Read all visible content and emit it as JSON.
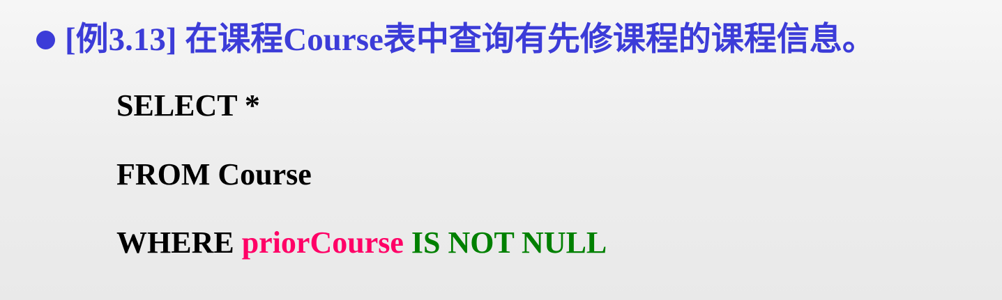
{
  "colors": {
    "heading": "#3c3cd8",
    "bullet": "#3c3cd8",
    "keyword": "#000000",
    "column": "#ff0066",
    "condition": "#008000"
  },
  "heading": {
    "bullet_icon": "filled-circle",
    "text": "[例3.13] 在课程Course表中查询有先修课程的课程信息。"
  },
  "sql": {
    "line1": "SELECT *",
    "line2": "FROM Course",
    "line3_keyword": "WHERE",
    "line3_column": "priorCourse",
    "line3_condition": "IS NOT NULL"
  }
}
